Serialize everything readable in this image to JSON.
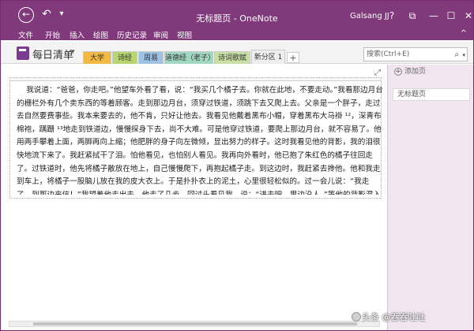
{
  "titlebar": {
    "title": "无标题页 - OneNote",
    "user": "Galsang JJ",
    "help": "?",
    "undo_icon": "↶",
    "dropdown_icon": "▾",
    "restore_icon": "⧉",
    "min_icon": "—",
    "max_icon": "☐",
    "close_icon": "✕"
  },
  "menu": {
    "items": [
      "文件",
      "开始",
      "插入",
      "绘图",
      "历史记录",
      "审阅",
      "视图"
    ],
    "caret": "^"
  },
  "notebook": {
    "name": "每日清单",
    "caret": "▾"
  },
  "sections": [
    {
      "label": "大学",
      "color": "#f4b942"
    },
    {
      "label": "诗经",
      "color": "#b7d66f"
    },
    {
      "label": "周易",
      "color": "#9ec1e6"
    },
    {
      "label": "道德经（老子）",
      "color": "#9fd7c2"
    },
    {
      "label": "诗词歌赋",
      "color": "#c9e0a5"
    },
    {
      "label": "新分区 1",
      "color": "#eeeeee"
    }
  ],
  "add_section": "+",
  "search": {
    "placeholder": "搜索(Ctrl+E)",
    "icon": "⌕",
    "dropdown": "▾"
  },
  "expand_icon": "⤢",
  "note": {
    "text": "    我说道：“爸爸，你走吧。”他望车外看了看，说：“我买几个橘子去。你就在此地，不要走动。”我看那边月台的栅栏外有几个卖东西的等着顾客。走到那边月台，须穿过铁道，须跳下去又爬上去。父亲是一个胖子，走过去自然要费事些。我本来要去的，他不肯，只好让他去。我看见他戴着黑布小帽，穿着黑布大马褂 ¹²，深青布棉袍，蹒跚 ¹³地走到铁道边，慢慢探身下去，尚不大难。可是他穿过铁道，要爬上那边月台，就不容易了。他用两手攀着上面，两脚再向上缩；他肥胖的身子向左微倾，显出努力的样子。这时我看见他的背影，我的泪很快地流下来了。我赶紧拭干了泪。怕他看见，也怕别人看见。我再向外看时，他已抱了朱红色的橘子往回走了。过铁道时，他先将橘子散放在地上，自己慢慢爬下，再抱起橘子走。到这边时，我赶紧去搀他。他和我走到车上，将橘子一股脑儿放在我的皮大衣上。于是扑扑衣上的泥土，心里很轻松似的。过一会儿说：“我走了，到那边来信！”我望着他走出去。他走了几步，回过头看见我，说：“进去吧，里边没人。”等他的背影混入来来往往的人里，再找不着了，我便进来坐下，我的眼泪又来了。"
  },
  "pages_panel": {
    "add_label": "添加页",
    "pages": [
      "无标题页"
    ]
  },
  "watermark": "头条 @吞吞吐吐"
}
